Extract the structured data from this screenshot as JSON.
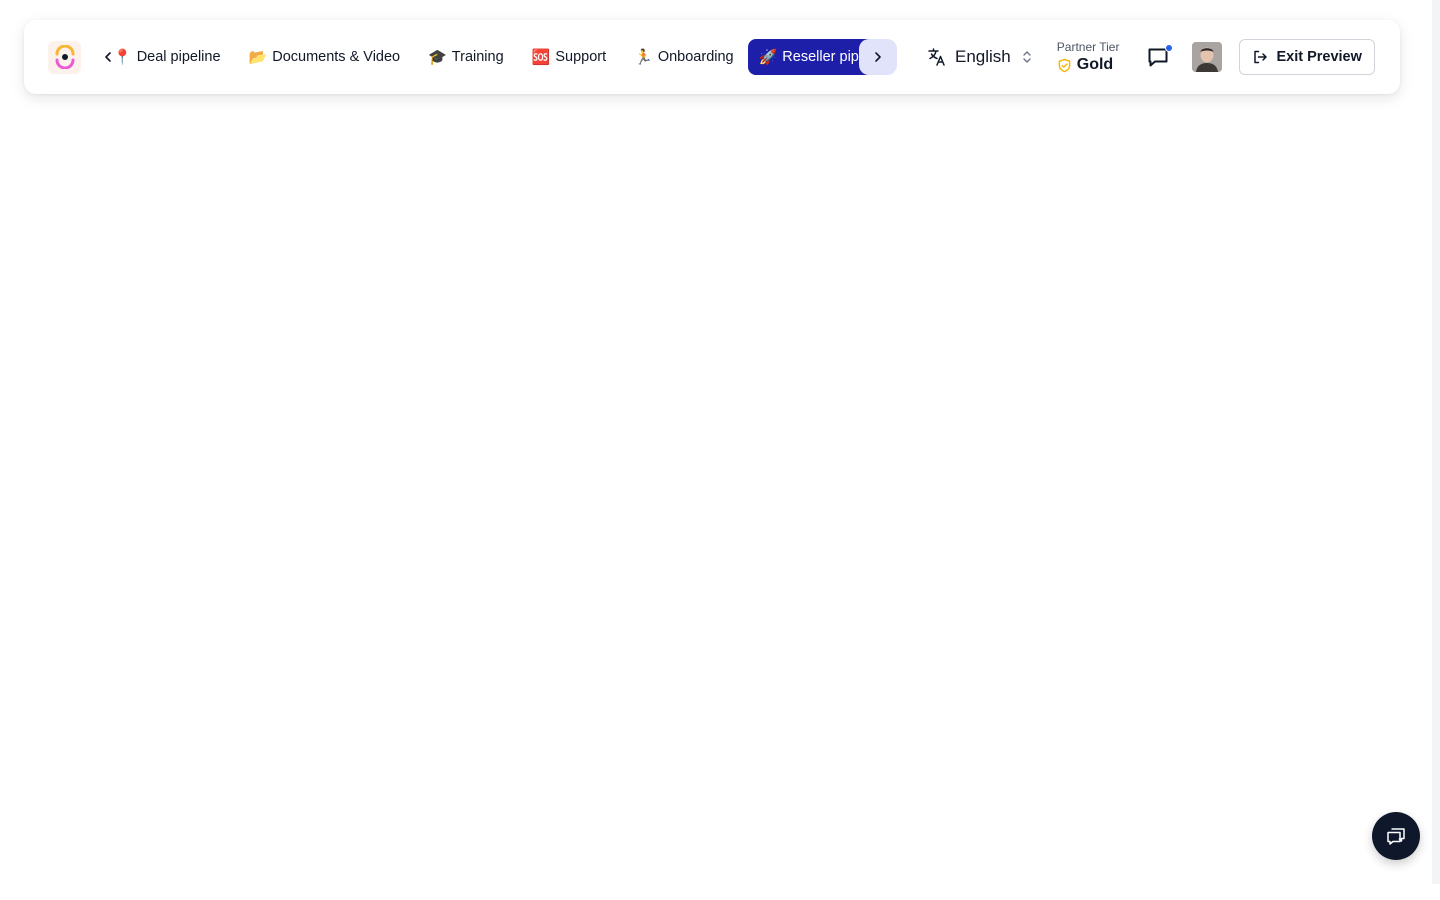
{
  "header": {
    "logo_icon": "brand-logo-icon",
    "tabs": [
      {
        "emoji": "📍",
        "label": "Deal pipeline"
      },
      {
        "emoji": "📂",
        "label": "Documents & Video"
      },
      {
        "emoji": "🎓",
        "label": "Training"
      },
      {
        "emoji": "🆘",
        "label": "Support"
      },
      {
        "emoji": "🏃",
        "label": "Onboarding"
      },
      {
        "emoji": "🚀",
        "label": "Reseller pipeline",
        "active": true
      }
    ],
    "language": {
      "icon": "translate-icon",
      "label": "English"
    },
    "partner_tier": {
      "title": "Partner Tier",
      "value": "Gold",
      "icon": "shield-check-icon"
    },
    "messages": {
      "icon": "chat-icon",
      "has_notification": true
    },
    "exit_preview": {
      "label": "Exit Preview",
      "icon": "logout-icon"
    }
  },
  "fab": {
    "icon": "chat-bubbles-icon"
  },
  "colors": {
    "active_tab": "#1e1fa8",
    "scroll_button": "#e0e3f9",
    "notification_dot": "#2563eb",
    "gold": "#f5b400",
    "fab": "#0f172a"
  }
}
